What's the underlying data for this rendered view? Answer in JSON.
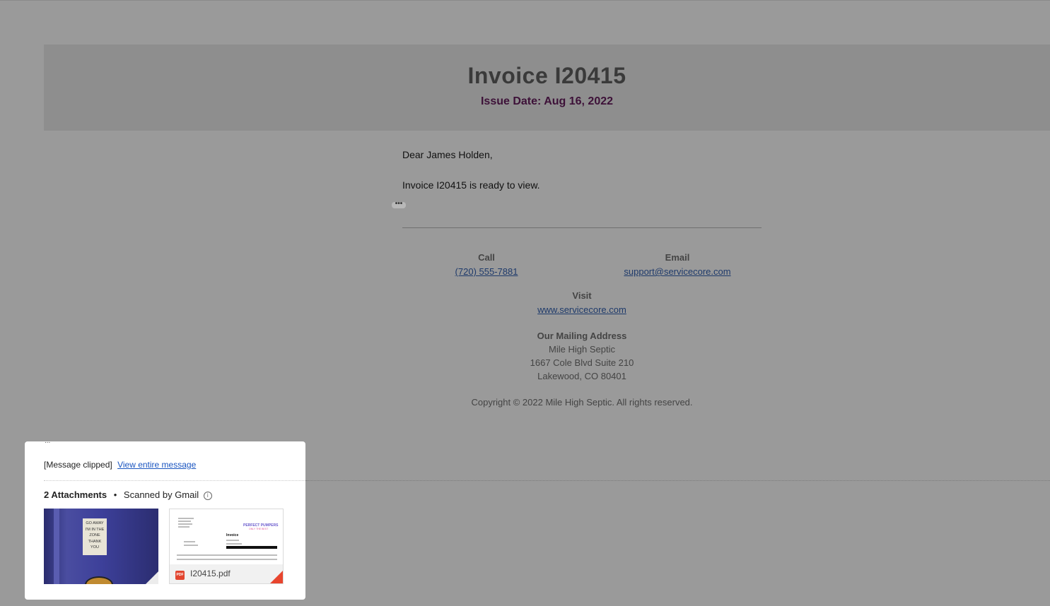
{
  "invoice": {
    "title": "Invoice I20415",
    "issue_date": "Issue Date: Aug 16, 2022"
  },
  "message": {
    "greeting": "Dear James Holden,",
    "body": "Invoice I20415 is ready to view.",
    "ellipsis": "•••"
  },
  "contact": {
    "call_label": "Call",
    "call_value": "(720) 555-7881",
    "email_label": "Email",
    "email_value": "support@servicecore.com",
    "visit_label": "Visit",
    "visit_value": "www.servicecore.com",
    "mailing_label": "Our Mailing Address",
    "mailing_lines": [
      "Mile High Septic",
      "1667 Cole Blvd Suite 210",
      "Lakewood, CO 80401"
    ]
  },
  "copyright": "Copyright © 2022 Mile High Septic. All rights reserved.",
  "attachments_panel": {
    "clipped_text": "[Message clipped]",
    "view_entire": "View entire message",
    "count_label": "2 Attachments",
    "separator": "•",
    "scanned": "Scanned by Gmail",
    "items": [
      {
        "type": "image",
        "sign_lines": [
          "GO AWAY",
          "I'M IN THE",
          "ZONE",
          "THANK",
          "YOU"
        ]
      },
      {
        "type": "pdf",
        "badge": "PDF",
        "filename": "I20415.pdf"
      }
    ]
  },
  "colors": {
    "background": "#9a9a9a",
    "date": "#3d1138",
    "link": "#1e3a6b",
    "pdf_badge": "#e2452f"
  },
  "icons": [
    "info-icon",
    "pdf-file-icon",
    "ellipsis-icon"
  ]
}
